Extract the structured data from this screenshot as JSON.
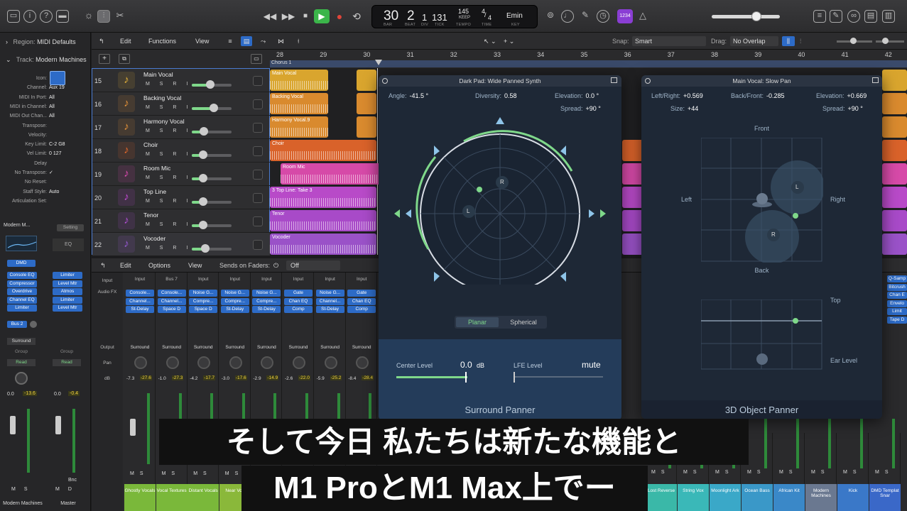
{
  "transport": {
    "bar": "30",
    "beat": "2",
    "div": "1",
    "tick": "131",
    "tempo": "145",
    "tempo_mode": "KEEP",
    "sig_top": "4",
    "sig_bottom": "4",
    "key": "Emin",
    "lbl_bar": "BAR",
    "lbl_beat": "BEAT",
    "lbl_div": "DIV",
    "lbl_tick": "TICK",
    "lbl_tempo": "TEMPO",
    "lbl_time": "TIME",
    "lbl_key": "KEY",
    "count_in": "1234"
  },
  "inspector": {
    "region_label": "Region:",
    "region_value": "MIDI Defaults",
    "track_label": "Track:",
    "track_value": "Modern Machines",
    "rows": [
      {
        "k": "Icon:",
        "v": ""
      },
      {
        "k": "Channel:",
        "v": "Aux 19"
      },
      {
        "k": "MIDI In Port:",
        "v": "All"
      },
      {
        "k": "MIDI in Channel:",
        "v": "All"
      },
      {
        "k": "MIDI Out Chan...",
        "v": "All"
      },
      {
        "k": "Transpose:",
        "v": ""
      },
      {
        "k": "Velocity:",
        "v": ""
      },
      {
        "k": "Key Limit:",
        "v": "C-2  G8"
      },
      {
        "k": "Vel Limit:",
        "v": "0  127"
      },
      {
        "k": "Delay",
        "v": ""
      },
      {
        "k": "No Transpose:",
        "v": "✓"
      },
      {
        "k": "No Reset:",
        "v": ""
      },
      {
        "k": "Staff Style:",
        "v": "Auto"
      },
      {
        "k": "Articulation Set:",
        "v": ""
      }
    ],
    "strip1": {
      "name": "Modern M...",
      "dmd": "DMD",
      "plugins": [
        "Console EQ",
        "Compressor",
        "Overdrive",
        "Channel EQ",
        "Limiter"
      ],
      "send": "Bus 2",
      "output": "Surround",
      "group": "Group",
      "read": "Read",
      "vol": "0.0",
      "peak": "-13.6",
      "footer": "Modern Machines"
    },
    "strip2": {
      "setting": "Setting",
      "eq": "EQ",
      "plugins": [
        "Limiter",
        "Level Mtr",
        "Atmos",
        "Limiter",
        "Level Mtr"
      ],
      "group": "Group",
      "read": "Read",
      "vol": "0.0",
      "peak": "-0.4",
      "bnc": "Bnc",
      "footer": "Master"
    }
  },
  "tracks_toolbar": {
    "edit": "Edit",
    "functions": "Functions",
    "view": "View",
    "snap_label": "Snap:",
    "snap_value": "Smart",
    "drag_label": "Drag:",
    "drag_value": "No Overlap"
  },
  "ruler": {
    "bars": [
      "28",
      "29",
      "30",
      "31",
      "32",
      "33",
      "34",
      "35",
      "36",
      "37",
      "38",
      "39",
      "40",
      "41",
      "42"
    ],
    "marker": "Chorus 1"
  },
  "tracks": [
    {
      "num": "15",
      "name": "Main Vocal",
      "icon": "♪",
      "color": "#e8b43a"
    },
    {
      "num": "16",
      "name": "Backing Vocal",
      "icon": "♪",
      "color": "#e8943a"
    },
    {
      "num": "17",
      "name": "Harmony Vocal",
      "icon": "♪",
      "color": "#e8943a"
    },
    {
      "num": "18",
      "name": "Choir",
      "icon": "♪",
      "color": "#e86a2a"
    },
    {
      "num": "19",
      "name": "Room Mic",
      "icon": "♪",
      "color": "#e24bb5"
    },
    {
      "num": "20",
      "name": "Top Line",
      "icon": "♪",
      "color": "#c64bd8"
    },
    {
      "num": "21",
      "name": "Tenor",
      "icon": "♪",
      "color": "#b450d8"
    },
    {
      "num": "22",
      "name": "Vocoder",
      "icon": "♪",
      "color": "#9a5ad8"
    }
  ],
  "track_btns": "M S R I",
  "regions": [
    {
      "label": "Main Vocal",
      "color": "#d9a52e"
    },
    {
      "label": "Backing Vocal",
      "color": "#d98a2e"
    },
    {
      "label": "Harmony Vocal.9",
      "color": "#d98a2e"
    },
    {
      "label": "Choir",
      "color": "#d9622a"
    },
    {
      "label": "Room Mic",
      "color": "#d64aa8"
    },
    {
      "label": "3  Top Line: Take 3",
      "color": "#b84ac8"
    },
    {
      "label": "Tenor",
      "color": "#a84ac8"
    },
    {
      "label": "Vocoder",
      "color": "#9a52c8"
    }
  ],
  "mixer_toolbar": {
    "edit": "Edit",
    "options": "Options",
    "view": "View",
    "sends_label": "Sends on Faders:",
    "sends_value": "Off"
  },
  "mixer_labels": {
    "input": "Input",
    "audio_fx": "Audio FX",
    "output": "Output",
    "pan": "Pan",
    "db": "dB"
  },
  "strips": [
    {
      "input": "Input",
      "fx": [
        "Console...",
        "Channel...",
        "St-Delay"
      ],
      "out": "Surround",
      "vol": "-7.3",
      "peak": "-27.6",
      "name": "Ghostly Vocals",
      "color": "#7ab83a"
    },
    {
      "input": "Bus 7",
      "fx": [
        "Console...",
        "Channel...",
        "Space D"
      ],
      "out": "Surround",
      "vol": "-1.0",
      "peak": "-27.3",
      "name": "Vocal Textures",
      "color": "#7ab83a"
    },
    {
      "input": "Input",
      "fx": [
        "Noise G...",
        "Compre...",
        "Space D"
      ],
      "out": "Surround",
      "vol": "-4.2",
      "peak": "-17.7",
      "name": "Distant Vocals",
      "color": "#7ab83a"
    },
    {
      "input": "Input",
      "fx": [
        "Noise G...",
        "Compre...",
        "St-Delay"
      ],
      "out": "Surround",
      "vol": "-3.0",
      "peak": "-17.6",
      "name": "Near Voc",
      "color": "#8ab83a"
    },
    {
      "input": "Input",
      "fx": [
        "Noise G...",
        "Compre...",
        "St-Delay"
      ],
      "out": "Surround",
      "vol": "-2.9",
      "peak": "-14.9",
      "name": "",
      "color": "#c8b83a"
    },
    {
      "input": "Input",
      "fx": [
        "Gate",
        "Chan EQ",
        "Comp"
      ],
      "out": "Surround",
      "vol": "-2.6",
      "peak": "-22.0",
      "name": "",
      "color": "#c8a83a"
    },
    {
      "input": "Input",
      "fx": [
        "Noise G...",
        "Channel...",
        "St-Delay"
      ],
      "out": "Surround",
      "vol": "-5.9",
      "peak": "-25.2",
      "name": "",
      "color": "#d8883a"
    },
    {
      "input": "Input",
      "fx": [
        "Gate",
        "Chan EQ",
        "Comp"
      ],
      "out": "Surround",
      "vol": "-8.4",
      "peak": "-28.4",
      "name": "",
      "color": "#d8683a"
    }
  ],
  "right_strips": [
    {
      "name": "Lost Reverse",
      "color": "#3ab8a8"
    },
    {
      "name": "String Vox",
      "color": "#3ab8b8"
    },
    {
      "name": "Moonlight Ark",
      "color": "#3aa8c8"
    },
    {
      "name": "Ocean Bass",
      "color": "#3a98c8"
    },
    {
      "name": "African Kit",
      "color": "#3a88c8"
    },
    {
      "name": "Modern Machines",
      "color": "#6a7890"
    },
    {
      "name": "Kick",
      "color": "#3a78c8"
    },
    {
      "name": "DMD Templat Snar",
      "color": "#3a68c8"
    }
  ],
  "right_fx": [
    "Q-Samp",
    "Bitcrush",
    "Chan E",
    "Envelo",
    "Limit",
    "Tape D"
  ],
  "surround_panner": {
    "title": "Dark Pad: Wide Panned Synth",
    "angle_label": "Angle:",
    "angle": "-41.5 °",
    "diversity_label": "Diversity:",
    "diversity": "0.58",
    "elevation_label": "Elevation:",
    "elevation": "0.0 °",
    "spread_label": "Spread:",
    "spread": "+90 °",
    "point_l": "L",
    "point_r": "R",
    "tab_planar": "Planar",
    "tab_spherical": "Spherical",
    "center_label": "Center Level",
    "center_value": "0.0",
    "center_unit": "dB",
    "lfe_label": "LFE Level",
    "lfe_value": "mute",
    "footer": "Surround Panner",
    "accent": "#7fd88a"
  },
  "object_panner": {
    "title": "Main Vocal: Slow Pan",
    "lr_label": "Left/Right:",
    "lr": "+0.569",
    "bf_label": "Back/Front:",
    "bf": "-0.285",
    "elev_label": "Elevation:",
    "elev": "+0.669",
    "size_label": "Size:",
    "size": "+44",
    "spread_label": "Spread:",
    "spread": "+90 °",
    "front": "Front",
    "back": "Back",
    "left": "Left",
    "right": "Right",
    "top": "Top",
    "ear_level": "Ear Level",
    "point_l": "L",
    "point_r": "R",
    "footer": "3D Object Panner"
  },
  "subtitles": {
    "line1": "そして今日 私たちは新たな機能と",
    "line2": "M1 ProとM1 Max上でー"
  }
}
